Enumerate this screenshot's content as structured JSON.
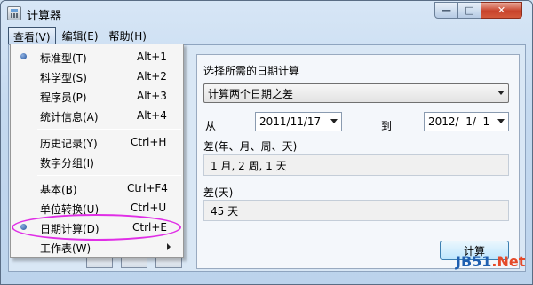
{
  "window": {
    "title": "计算器",
    "controls": {
      "minimize": "—",
      "maximize": "□",
      "close": "✕"
    }
  },
  "menubar": {
    "items": [
      {
        "label": "查看(V)",
        "active": true
      },
      {
        "label": "编辑(E)",
        "active": false
      },
      {
        "label": "帮助(H)",
        "active": false
      }
    ]
  },
  "view_menu": {
    "items": [
      {
        "label": "标准型(T)",
        "shortcut": "Alt+1",
        "selected": true
      },
      {
        "label": "科学型(S)",
        "shortcut": "Alt+2",
        "selected": false
      },
      {
        "label": "程序员(P)",
        "shortcut": "Alt+3",
        "selected": false
      },
      {
        "label": "统计信息(A)",
        "shortcut": "Alt+4",
        "selected": false
      },
      {
        "label": "历史记录(Y)",
        "shortcut": "Ctrl+H",
        "selected": false
      },
      {
        "label": "数字分组(I)",
        "shortcut": "",
        "selected": false
      },
      {
        "label": "基本(B)",
        "shortcut": "Ctrl+F4",
        "selected": false
      },
      {
        "label": "单位转换(U)",
        "shortcut": "Ctrl+U",
        "selected": false
      },
      {
        "label": "日期计算(D)",
        "shortcut": "Ctrl+E",
        "selected": true
      },
      {
        "label": "工作表(W)",
        "shortcut": "",
        "submenu": true
      }
    ]
  },
  "date_panel": {
    "prompt": "选择所需的日期计算",
    "mode_selected": "计算两个日期之差",
    "from_label": "从",
    "from_value": "2011/11/17",
    "to_label": "到",
    "to_value": "2012/  1/  1",
    "diff_label": "差(年、月、周、天)",
    "diff_value": "1 月, 2 周, 1 天",
    "days_label": "差(天)",
    "days_value": "45 天",
    "calculate_button": "计算"
  },
  "watermark": {
    "left": "JB51",
    "right": ".Net"
  },
  "colors": {
    "highlight_ellipse": "#e02ee6",
    "close_button": "#c8432b",
    "selection_dot": "#1f4f9a"
  }
}
